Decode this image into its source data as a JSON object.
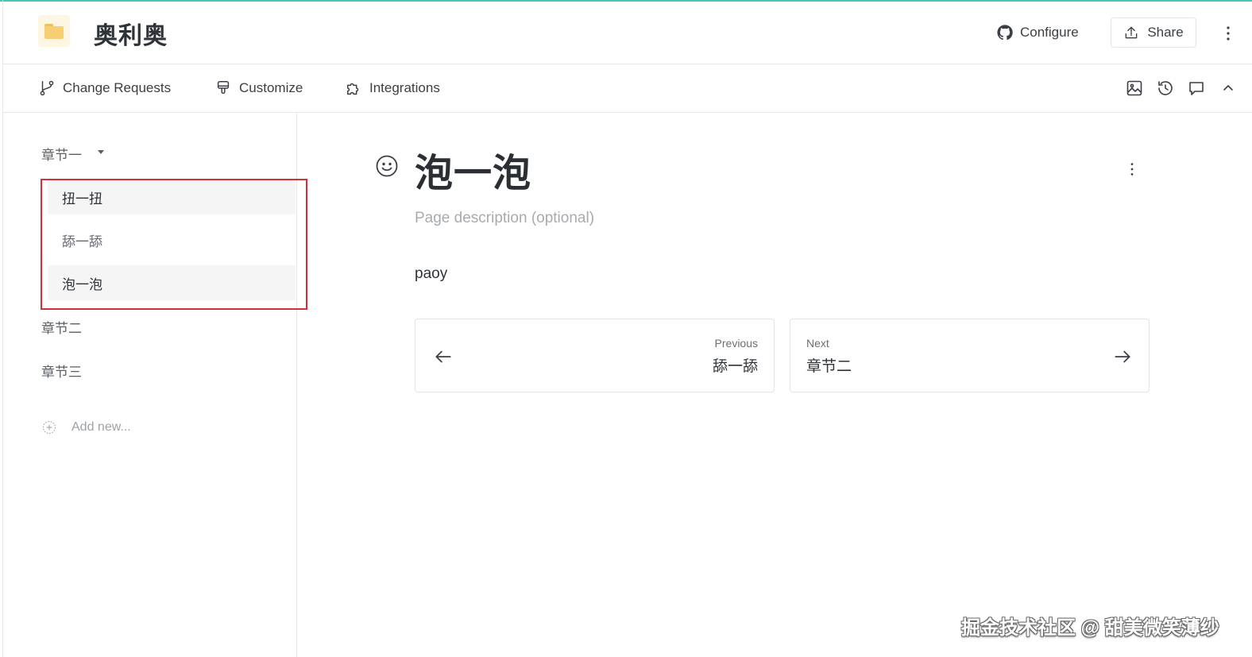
{
  "header": {
    "space_title": "奥利奥",
    "configure_label": "Configure",
    "share_label": "Share"
  },
  "toolbar": {
    "change_requests_label": "Change Requests",
    "customize_label": "Customize",
    "integrations_label": "Integrations"
  },
  "sidebar": {
    "sections": [
      "章节一",
      "章节二",
      "章节三"
    ],
    "pages": [
      "扭一扭",
      "舔一舔",
      "泡一泡"
    ],
    "add_new_label": "Add new..."
  },
  "page": {
    "title": "泡一泡",
    "description_placeholder": "Page description (optional)",
    "body_text": "paoy"
  },
  "navigation": {
    "previous_label": "Previous",
    "previous_title": "舔一舔",
    "next_label": "Next",
    "next_title": "章节二"
  },
  "watermark": "掘金技术社区 @ 甜美微笑薄纱",
  "colors": {
    "accent_top_line": "#46c7b5",
    "annotation_box": "#d2303b",
    "text_primary": "#2f3338",
    "text_muted": "#a7abb0"
  }
}
